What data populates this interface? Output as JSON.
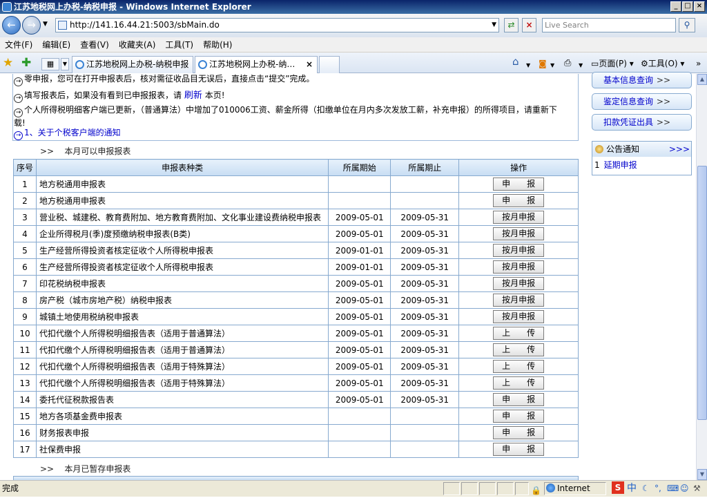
{
  "window": {
    "title": "江苏地税网上办税-纳税申报 - Windows Internet Explorer"
  },
  "address": {
    "url": "http://141.16.44.21:5003/sbMain.do",
    "search_placeholder": "Live Search"
  },
  "menu": [
    "文件(F)",
    "编辑(E)",
    "查看(V)",
    "收藏夹(A)",
    "工具(T)",
    "帮助(H)"
  ],
  "tabs": [
    {
      "label": "江苏地税网上办税-纳税申报"
    },
    {
      "label": "江苏地税网上办税-纳…"
    }
  ],
  "commands": {
    "page": "页面(P)",
    "tools": "工具(O)"
  },
  "notices": {
    "n1": "零申报，您可在打开申报表后，核对需征收品目无误后，直接点击“提交”完成。",
    "n2_pre": "填写报表后，如果没有看到已申报报表，请",
    "n2_link": "刷新",
    "n2_post": "本页!",
    "n3": "个人所得税明细客户端已更新，（普通算法）中增加了010006工资、薪金所得（扣缴单位在月内多次发放工薪，补充申报）的所得项目，请重新下载!",
    "n4": "1、关于个税客户端的通知"
  },
  "sections": {
    "current": ">>    本月可以申报报表",
    "saved": ">>    本月已暂存申报表"
  },
  "table": {
    "headers": [
      "序号",
      "申报表种类",
      "所属期始",
      "所属期止",
      "操作"
    ],
    "rows": [
      {
        "no": "1",
        "name": "地方税通用申报表",
        "start": "",
        "end": "",
        "op": "申　　报"
      },
      {
        "no": "2",
        "name": "地方税通用申报表",
        "start": "",
        "end": "",
        "op": "申　　报"
      },
      {
        "no": "3",
        "name": "营业税、城建税、教育费附加、地方教育费附加、文化事业建设费纳税申报表",
        "start": "2009-05-01",
        "end": "2009-05-31",
        "op": "按月申报"
      },
      {
        "no": "4",
        "name": "企业所得税月(季)度预缴纳税申报表(B类)",
        "start": "2009-05-01",
        "end": "2009-05-31",
        "op": "按月申报"
      },
      {
        "no": "5",
        "name": "生产经营所得投资者核定征收个人所得税申报表",
        "start": "2009-01-01",
        "end": "2009-05-31",
        "op": "按月申报"
      },
      {
        "no": "6",
        "name": "生产经营所得投资者核定征收个人所得税申报表",
        "start": "2009-01-01",
        "end": "2009-05-31",
        "op": "按月申报"
      },
      {
        "no": "7",
        "name": "印花税纳税申报表",
        "start": "2009-05-01",
        "end": "2009-05-31",
        "op": "按月申报"
      },
      {
        "no": "8",
        "name": "房产税（城市房地产税）纳税申报表",
        "start": "2009-05-01",
        "end": "2009-05-31",
        "op": "按月申报"
      },
      {
        "no": "9",
        "name": "城镇土地使用税纳税申报表",
        "start": "2009-05-01",
        "end": "2009-05-31",
        "op": "按月申报"
      },
      {
        "no": "10",
        "name": "代扣代缴个人所得税明细报告表（适用于普通算法）",
        "start": "2009-05-01",
        "end": "2009-05-31",
        "op": "上　　传"
      },
      {
        "no": "11",
        "name": "代扣代缴个人所得税明细报告表（适用于普通算法）",
        "start": "2009-05-01",
        "end": "2009-05-31",
        "op": "上　　传"
      },
      {
        "no": "12",
        "name": "代扣代缴个人所得税明细报告表（适用于特殊算法）",
        "start": "2009-05-01",
        "end": "2009-05-31",
        "op": "上　　传"
      },
      {
        "no": "13",
        "name": "代扣代缴个人所得税明细报告表（适用于特殊算法）",
        "start": "2009-05-01",
        "end": "2009-05-31",
        "op": "上　　传"
      },
      {
        "no": "14",
        "name": "委托代征税款报告表",
        "start": "2009-05-01",
        "end": "2009-05-31",
        "op": "申　　报"
      },
      {
        "no": "15",
        "name": "地方各项基金费申报表",
        "start": "",
        "end": "",
        "op": "申　　报"
      },
      {
        "no": "16",
        "name": "财务报表申报",
        "start": "",
        "end": "",
        "op": "申　　报"
      },
      {
        "no": "17",
        "name": "社保费申报",
        "start": "",
        "end": "",
        "op": "申　　报"
      }
    ]
  },
  "sidebar": {
    "buttons": [
      "基本信息查询",
      "鉴定信息查询",
      "扣款凭证出具"
    ],
    "chevron": ">>",
    "notice_title": "公告通知",
    "notice_more": ">>>",
    "notice_item_no": "1",
    "notice_item": "延期申报"
  },
  "status": {
    "text": "完成",
    "zone": "Internet"
  }
}
